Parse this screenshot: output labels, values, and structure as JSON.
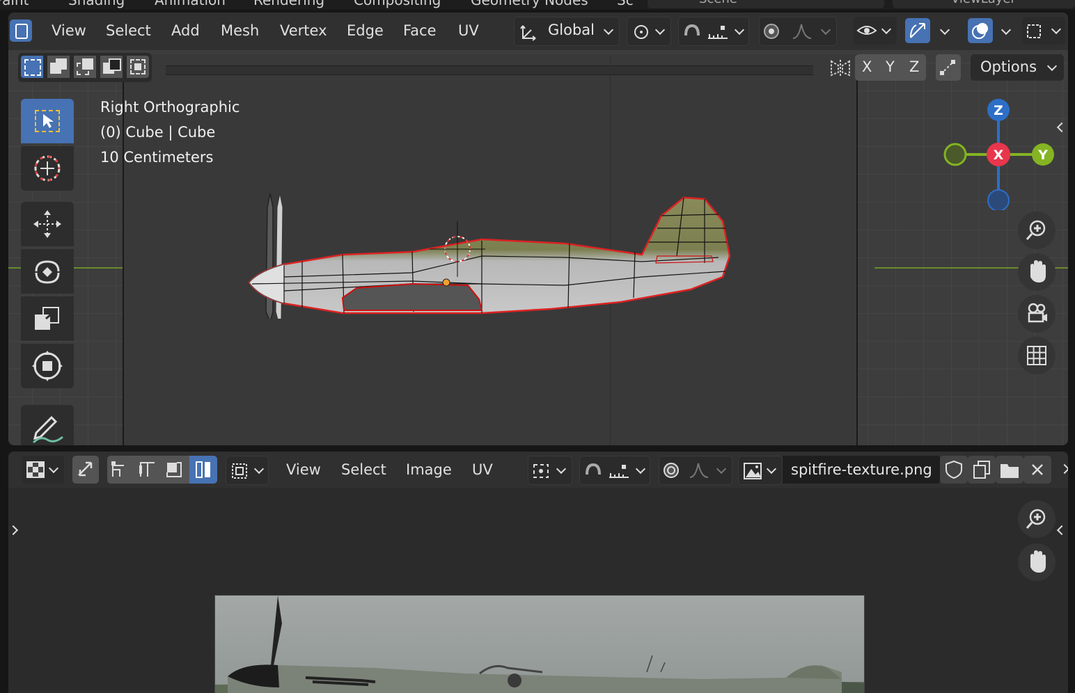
{
  "workspace_tabs": [
    "Paint",
    "Shading",
    "Animation",
    "Rendering",
    "Compositing",
    "Geometry Nodes",
    "Sc"
  ],
  "scene_label": "Scene",
  "viewlayer_label": "ViewLayer",
  "viewport": {
    "menus": [
      "View",
      "Select",
      "Add",
      "Mesh",
      "Vertex",
      "Edge",
      "Face",
      "UV"
    ],
    "transform_orientation": "Global",
    "axis_buttons": [
      "X",
      "Y",
      "Z"
    ],
    "options_label": "Options",
    "overlay_lines": [
      "Right Orthographic",
      "(0) Cube | Cube",
      "10 Centimeters"
    ],
    "gizmo_axes": {
      "z": "Z",
      "x": "X",
      "y": "Y"
    },
    "colors": {
      "x": "#e8364c",
      "y": "#84b423",
      "z": "#2d6fc7",
      "active": "#4772b3"
    }
  },
  "uv_editor": {
    "menus": [
      "View",
      "Select",
      "Image",
      "UV"
    ],
    "image_name": "spitfire-texture.png"
  }
}
